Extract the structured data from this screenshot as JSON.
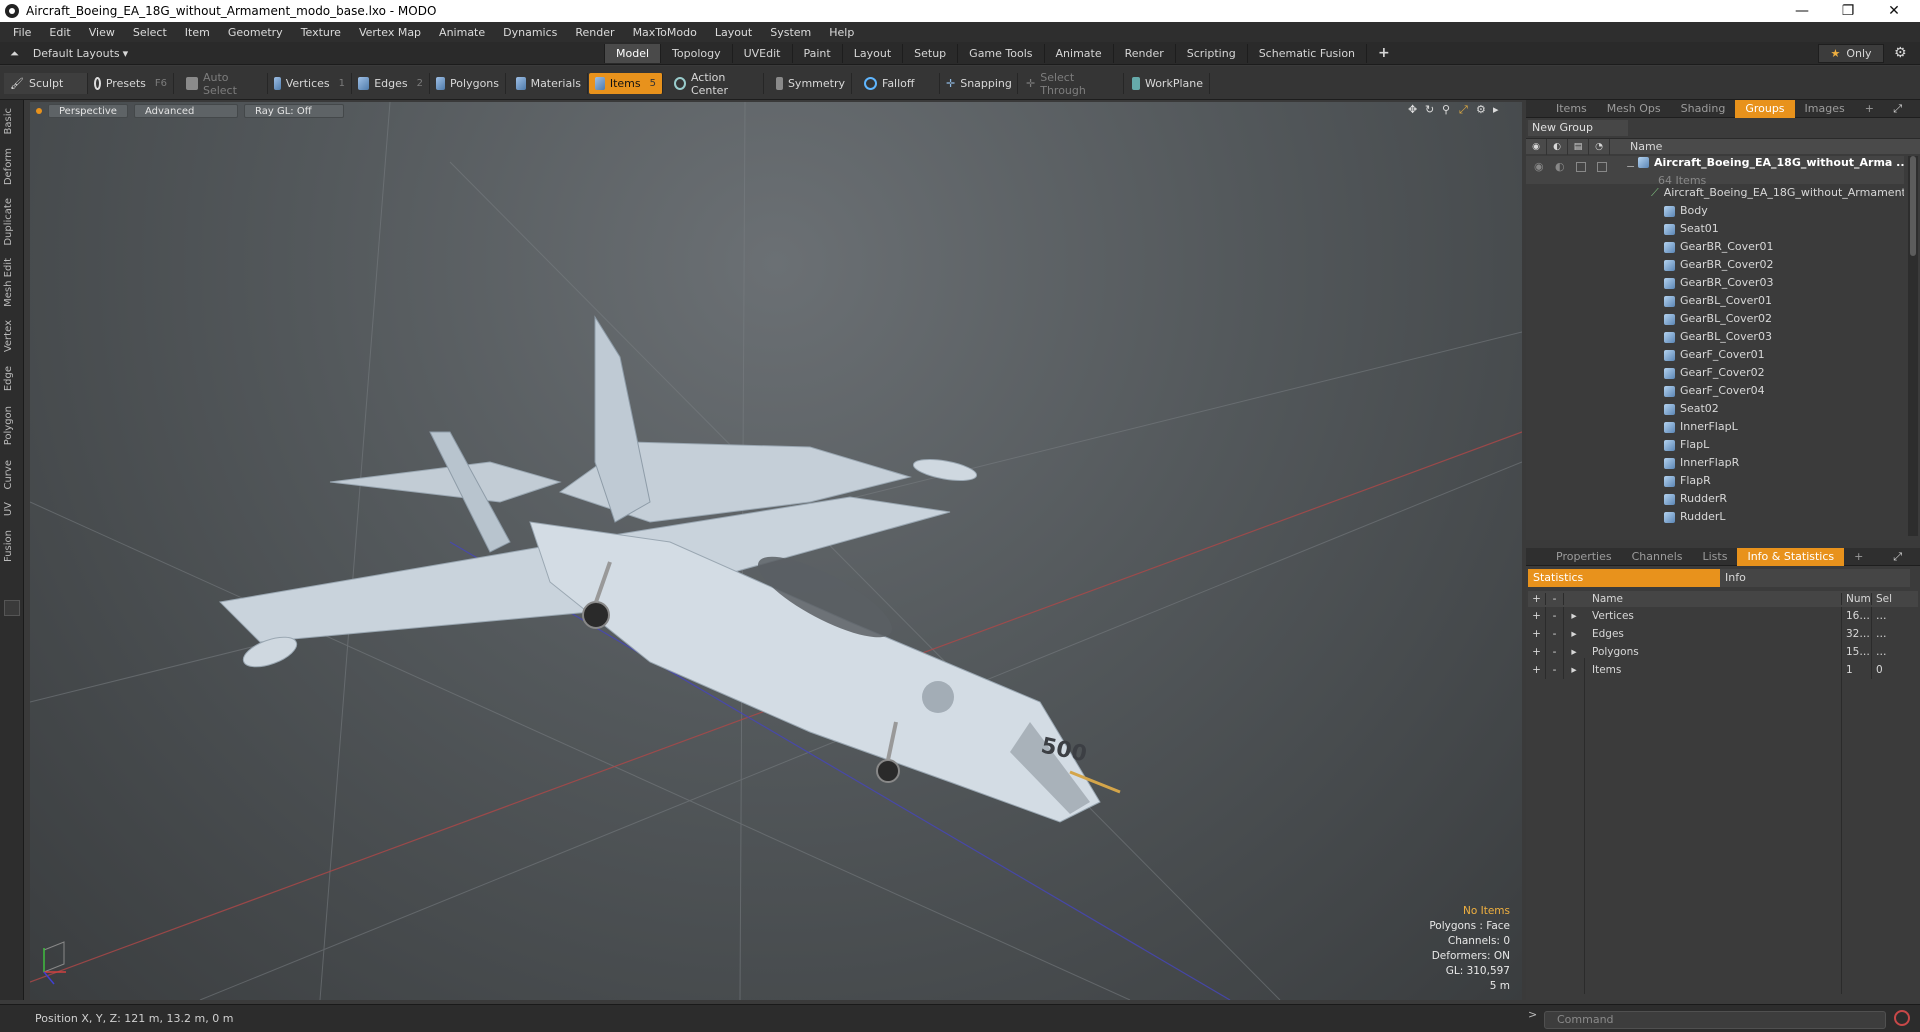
{
  "window": {
    "title": "Aircraft_Boeing_EA_18G_without_Armament_modo_base.lxo - MODO",
    "minimize": "—",
    "maximize": "❐",
    "close": "✕"
  },
  "menu": [
    "File",
    "Edit",
    "View",
    "Select",
    "Item",
    "Geometry",
    "Texture",
    "Vertex Map",
    "Animate",
    "Dynamics",
    "Render",
    "MaxToModo",
    "Layout",
    "System",
    "Help"
  ],
  "layout": {
    "label": "Default Layouts",
    "arrow": "▾"
  },
  "mode_tabs": [
    "Model",
    "Topology",
    "UVEdit",
    "Paint",
    "Layout",
    "Setup",
    "Game Tools",
    "Animate",
    "Render",
    "Scripting",
    "Schematic Fusion"
  ],
  "mode_add": "+",
  "only_label": "Only",
  "toolbar": {
    "sculpt": "Sculpt",
    "presets": "Presets",
    "presets_key": "F6",
    "auto_select": "Auto Select",
    "vertices": "Vertices",
    "vertices_key": "1",
    "edges": "Edges",
    "edges_key": "2",
    "polygons": "Polygons",
    "materials": "Materials",
    "items": "Items",
    "items_key": "5",
    "action_center": "Action Center",
    "symmetry": "Symmetry",
    "falloff": "Falloff",
    "snapping": "Snapping",
    "select_through": "Select Through",
    "workplane": "WorkPlane"
  },
  "left_tabs": [
    "Basic",
    "Deform",
    "Duplicate",
    "Mesh Edit",
    "Vertex",
    "Edge",
    "Polygon",
    "Curve",
    "UV",
    "Fusion"
  ],
  "viewport": {
    "view": "Perspective",
    "advanced": "Advanced",
    "raygl": "Ray GL: Off",
    "stats": {
      "items": "No Items",
      "polygons": "Polygons : Face",
      "channels": "Channels: 0",
      "deformers": "Deformers: ON",
      "gl": "GL: 310,597",
      "scale": "5 m"
    },
    "aircraft_number": "500"
  },
  "items_panel": {
    "tabs": [
      "Items",
      "Mesh Ops",
      "Shading",
      "Groups",
      "Images"
    ],
    "active_tab": "Groups",
    "add": "+",
    "new_group": "New Group",
    "name_header": "Name",
    "root": {
      "name": "Aircraft_Boeing_EA_18G_without_Arma ...",
      "count": "64 Items"
    },
    "children": [
      "Aircraft_Boeing_EA_18G_without_Armament",
      "Body",
      "Seat01",
      "GearBR_Cover01",
      "GearBR_Cover02",
      "GearBR_Cover03",
      "GearBL_Cover01",
      "GearBL_Cover02",
      "GearBL_Cover03",
      "GearF_Cover01",
      "GearF_Cover02",
      "GearF_Cover04",
      "Seat02",
      "InnerFlapL",
      "FlapL",
      "InnerFlapR",
      "FlapR",
      "RudderR",
      "RudderL"
    ]
  },
  "props_panel": {
    "tabs": [
      "Properties",
      "Channels",
      "Lists",
      "Info & Statistics"
    ],
    "active_tab": "Info & Statistics",
    "add": "+",
    "subtabs": [
      "Statistics",
      "Info"
    ],
    "headers": {
      "name": "Name",
      "num": "Num",
      "sel": "Sel"
    },
    "rows": [
      {
        "name": "Vertices",
        "num": "16…",
        "sel": "…"
      },
      {
        "name": "Edges",
        "num": "32…",
        "sel": "…"
      },
      {
        "name": "Polygons",
        "num": "15…",
        "sel": "…"
      },
      {
        "name": "Items",
        "num": "1",
        "sel": "0"
      }
    ]
  },
  "status": {
    "position": "Position X, Y, Z:   121 m, 13.2 m, 0 m"
  },
  "command": {
    "prompt": ">",
    "placeholder": "Command"
  }
}
